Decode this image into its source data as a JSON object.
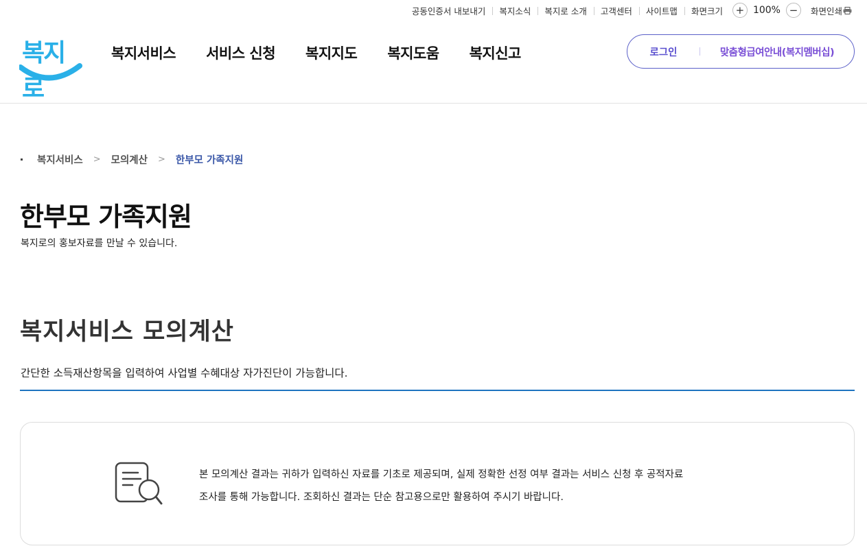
{
  "util": {
    "links": [
      "공동인증서 내보내기",
      "복지소식",
      "복지로 소개",
      "고객센터",
      "사이트맵",
      "화면크기"
    ],
    "zoom_in": "+",
    "zoom_value": "100%",
    "zoom_out": "−",
    "print_label": "화면인쇄"
  },
  "header": {
    "logo_text": "복지로",
    "nav": [
      "복지서비스",
      "서비스 신청",
      "복지지도",
      "복지도움",
      "복지신고"
    ],
    "login_label": "로그인",
    "membership_label": "맞춤형급여안내(복지멤버십)"
  },
  "breadcrumb": [
    "복지서비스",
    "모의계산",
    "한부모 가족지원"
  ],
  "page": {
    "title": "한부모 가족지원",
    "description": "복지로의 홍보자료를 만날 수 있습니다."
  },
  "section": {
    "title": "복지서비스 모의계산",
    "description": "간단한 소득재산항목을 입력하여 사업별 수혜대상 자가진단이 가능합니다."
  },
  "notice": {
    "lines": [
      "본 모의계산 결과는 귀하가 입력하신 자료를 기초로 제공되며, 실제 정확한 선정 여부 결과는 서비스 신청 후 공적자료",
      "조사를 통해 가능합니다. 조회하신 결과는 단순 참고용으로만 활용하여 주시기 바랍니다."
    ],
    "icon": "document-search-icon"
  },
  "colors": {
    "brand": "#2ab0e8",
    "accent_blue": "#1e73c0",
    "membership_purple": "#5a5fc8",
    "breadcrumb_current": "#3a57a8"
  }
}
